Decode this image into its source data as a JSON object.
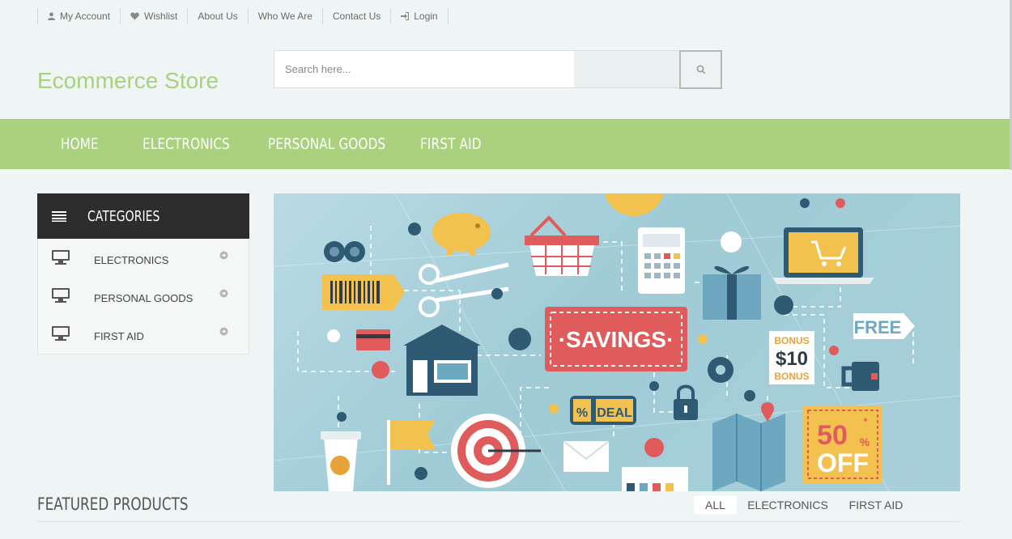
{
  "topbar": {
    "links": [
      {
        "label": "My Account",
        "icon": "user-icon"
      },
      {
        "label": "Wishlist",
        "icon": "heart-icon"
      },
      {
        "label": "About Us"
      },
      {
        "label": "Who We Are"
      },
      {
        "label": "Contact Us"
      },
      {
        "label": "Login",
        "icon": "sign-in-icon"
      }
    ]
  },
  "header": {
    "logo": "Ecommerce Store",
    "search_placeholder": "Search here..."
  },
  "nav": {
    "items": [
      "HOME",
      "ELECTRONICS",
      "PERSONAL GOODS",
      "FIRST AID"
    ]
  },
  "categories": {
    "title": "CATEGORIES",
    "items": [
      "ELECTRONICS",
      "PERSONAL GOODS",
      "FIRST AID"
    ]
  },
  "banner": {
    "savings": "·SAVINGS·",
    "free": "FREE",
    "bonus_top": "BONUS",
    "bonus_amount": "$10",
    "bonus_bottom": "BONUS",
    "deal_pct": "%",
    "deal": "DEAL",
    "off_pct": "50",
    "off_sign": "%",
    "off_star": "*",
    "off": "OFF"
  },
  "featured": {
    "title": "FEATURED PRODUCTS",
    "tabs": [
      "ALL",
      "ELECTRONICS",
      "FIRST AID"
    ],
    "active_tab": "ALL"
  },
  "colors": {
    "accent": "#a9d17e",
    "dark": "#2d2d2d",
    "background": "#eff4f4"
  }
}
